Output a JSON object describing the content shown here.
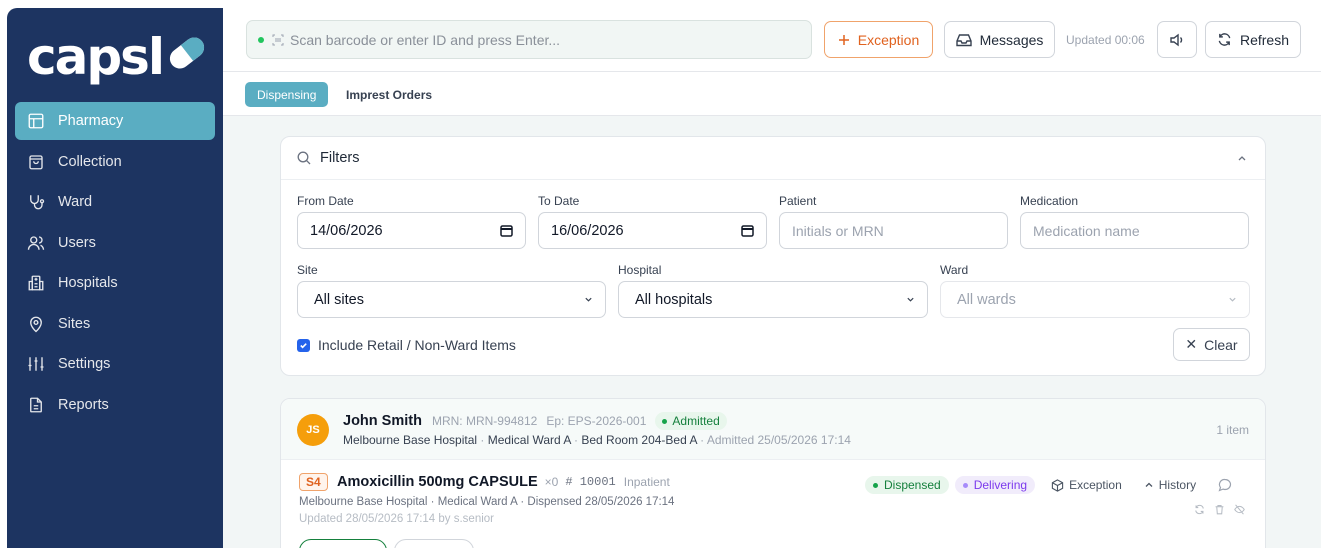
{
  "brand": {
    "logo_text": "capsl"
  },
  "sidebar": {
    "items": [
      {
        "label": "Pharmacy",
        "icon": "layout-icon",
        "active": true
      },
      {
        "label": "Collection",
        "icon": "shopping-bag-icon"
      },
      {
        "label": "Ward",
        "icon": "stethoscope-icon"
      },
      {
        "label": "Users",
        "icon": "users-icon"
      },
      {
        "label": "Hospitals",
        "icon": "hospital-icon"
      },
      {
        "label": "Sites",
        "icon": "map-pin-icon"
      },
      {
        "label": "Settings",
        "icon": "sliders-icon"
      },
      {
        "label": "Reports",
        "icon": "file-text-icon"
      }
    ]
  },
  "topbar": {
    "scan_placeholder": "Scan barcode or enter ID and press Enter...",
    "exception_label": "Exception",
    "messages_label": "Messages",
    "updated_text": "Updated 00:06",
    "refresh_label": "Refresh"
  },
  "tabs": [
    {
      "label": "Dispensing",
      "active": true
    },
    {
      "label": "Imprest Orders"
    }
  ],
  "filters": {
    "title": "Filters",
    "from_date_label": "From Date",
    "from_date_value": "14/06/2026",
    "to_date_label": "To Date",
    "to_date_value": "16/06/2026",
    "patient_label": "Patient",
    "patient_placeholder": "Initials or MRN",
    "medication_label": "Medication",
    "medication_placeholder": "Medication name",
    "site_label": "Site",
    "site_value": "All sites",
    "hospital_label": "Hospital",
    "hospital_value": "All hospitals",
    "ward_label": "Ward",
    "ward_value": "All wards",
    "include_retail_label": "Include Retail / Non-Ward Items",
    "include_retail_checked": true,
    "clear_label": "Clear"
  },
  "patient": {
    "initials": "JS",
    "name": "John Smith",
    "mrn": "MRN: MRN-994812",
    "episode": "Ep: EPS-2026-001",
    "status": "Admitted",
    "hospital": "Melbourne Base Hospital",
    "ward": "Medical Ward A",
    "bed": "Bed Room 204-Bed A",
    "admitted": "Admitted 25/05/2026 17:14",
    "item_count": "1 item",
    "med": {
      "schedule": "S4",
      "name": "Amoxicillin 500mg CAPSULE",
      "qty": "×0",
      "id": "# 10001",
      "type": "Inpatient",
      "location": "Melbourne Base Hospital · Medical Ward A · Dispensed 28/05/2026 17:14",
      "updated": "Updated 28/05/2026 17:14 by s.senior",
      "status_dispensed": "Dispensed",
      "status_delivering": "Delivering",
      "exception_label": "Exception",
      "history_label": "History"
    }
  },
  "colors": {
    "sidebar_bg": "#1d3461",
    "accent": "#5aadc2",
    "exception_orange": "#e0621f"
  }
}
